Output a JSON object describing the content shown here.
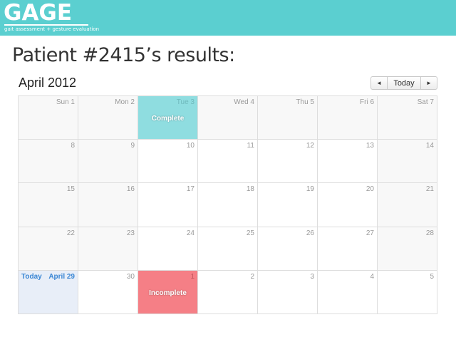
{
  "logo": {
    "word": "GAGE",
    "tagline": "gait assessment + gesture evaluation"
  },
  "heading": "Patient #2415’s results:",
  "calendar": {
    "month_title": "April 2012",
    "nav": {
      "prev": "◄",
      "today": "Today",
      "next": "►"
    },
    "weeks": [
      [
        {
          "num": "Sun 1",
          "state": "other"
        },
        {
          "num": "Mon 2",
          "state": "other"
        },
        {
          "num": "Tue 3",
          "state": "complete",
          "event": "Complete"
        },
        {
          "num": "Wed 4",
          "state": "other"
        },
        {
          "num": "Thu 5",
          "state": "other"
        },
        {
          "num": "Fri 6",
          "state": "other"
        },
        {
          "num": "Sat 7",
          "state": "other"
        }
      ],
      [
        {
          "num": "8",
          "state": "other"
        },
        {
          "num": "9",
          "state": "other"
        },
        {
          "num": "10",
          "state": "normal"
        },
        {
          "num": "11",
          "state": "normal"
        },
        {
          "num": "12",
          "state": "normal"
        },
        {
          "num": "13",
          "state": "normal"
        },
        {
          "num": "14",
          "state": "other"
        }
      ],
      [
        {
          "num": "15",
          "state": "other"
        },
        {
          "num": "16",
          "state": "other"
        },
        {
          "num": "17",
          "state": "normal"
        },
        {
          "num": "18",
          "state": "normal"
        },
        {
          "num": "19",
          "state": "normal"
        },
        {
          "num": "20",
          "state": "normal"
        },
        {
          "num": "21",
          "state": "other"
        }
      ],
      [
        {
          "num": "22",
          "state": "other"
        },
        {
          "num": "23",
          "state": "other"
        },
        {
          "num": "24",
          "state": "normal"
        },
        {
          "num": "25",
          "state": "normal"
        },
        {
          "num": "26",
          "state": "normal"
        },
        {
          "num": "27",
          "state": "normal"
        },
        {
          "num": "28",
          "state": "other"
        }
      ],
      [
        {
          "num": "April 29",
          "state": "today",
          "label": "Today"
        },
        {
          "num": "30",
          "state": "normal"
        },
        {
          "num": "1",
          "state": "incomplete",
          "event": "Incomplete"
        },
        {
          "num": "2",
          "state": "normal"
        },
        {
          "num": "3",
          "state": "normal"
        },
        {
          "num": "4",
          "state": "normal"
        },
        {
          "num": "5",
          "state": "normal"
        }
      ]
    ]
  },
  "colors": {
    "banner": "#5bcfd0",
    "complete": "#8fdde0",
    "incomplete": "#f57f86",
    "today": "#e8eef8",
    "today_text": "#3a86d4"
  }
}
